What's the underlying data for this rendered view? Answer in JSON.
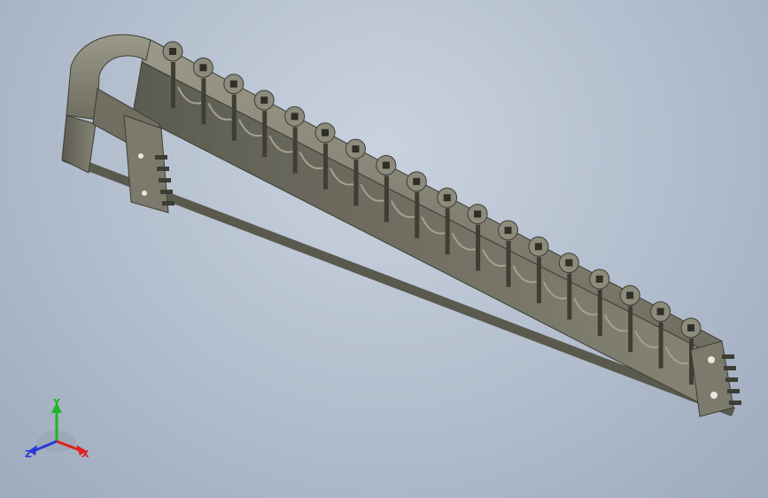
{
  "viewport": {
    "background_top": "#c9d2df",
    "background_bottom": "#9eabbd"
  },
  "model": {
    "part_color": "#7c7b6d",
    "part_shadow": "#4a4a40",
    "part_highlight": "#a7a696"
  },
  "triad": {
    "x_label": "X",
    "y_label": "Y",
    "z_label": "Z",
    "x_color": "#e02020",
    "y_color": "#22b522",
    "z_color": "#2a39d8"
  }
}
